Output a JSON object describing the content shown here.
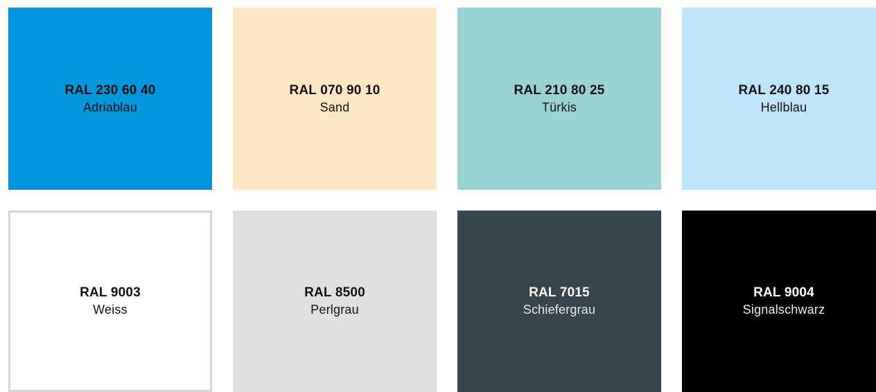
{
  "swatches": [
    {
      "code": "RAL 230 60 40",
      "name": "Adriablau",
      "color": "#0096db",
      "text_color": "#111111"
    },
    {
      "code": "RAL 070 90 10",
      "name": "Sand",
      "color": "#fee8c3",
      "text_color": "#111111"
    },
    {
      "code": "RAL 210 80 25",
      "name": "Türkis",
      "color": "#98d2d3",
      "text_color": "#111111"
    },
    {
      "code": "RAL 240 80 15",
      "name": "Hellblau",
      "color": "#bde4f9",
      "text_color": "#111111"
    },
    {
      "code": "RAL 9003",
      "name": "Weiss",
      "color": "#ffffff",
      "text_color": "#111111",
      "border_color": "#d6d6d6"
    },
    {
      "code": "RAL 8500",
      "name": "Perlgrau",
      "color": "#e0e0df",
      "text_color": "#111111"
    },
    {
      "code": "RAL 7015",
      "name": "Schiefergrau",
      "color": "#36444c",
      "text_color": "#ffffff"
    },
    {
      "code": "RAL 9004",
      "name": "Signalschwarz",
      "color": "#000000",
      "text_color": "#ffffff"
    }
  ]
}
